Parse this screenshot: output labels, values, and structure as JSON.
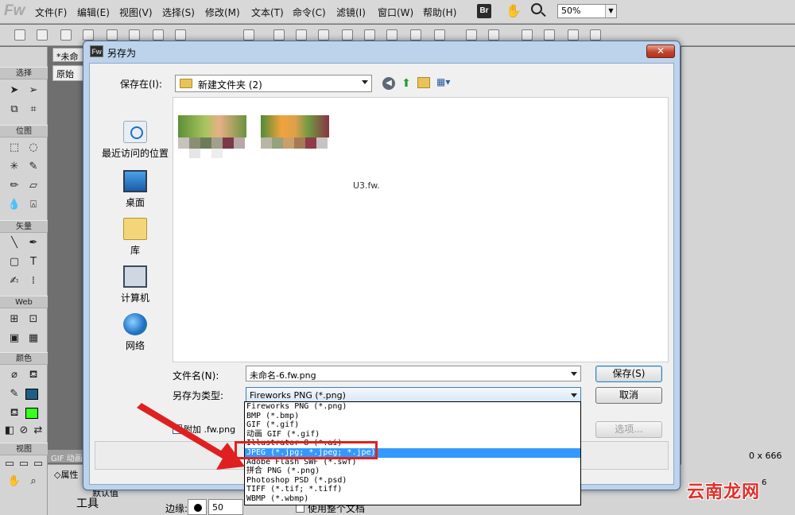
{
  "app": {
    "logo": "Fw"
  },
  "menubar": {
    "items": [
      "文件(F)",
      "编辑(E)",
      "视图(V)",
      "选择(S)",
      "修改(M)",
      "文本(T)",
      "命令(C)",
      "滤镜(I)",
      "窗口(W)",
      "帮助(H)"
    ],
    "br_label": "Br",
    "zoom": "50%"
  },
  "tools": {
    "sections": [
      "选择",
      "位图",
      "矢量",
      "Web",
      "颜色",
      "视图"
    ]
  },
  "document": {
    "tab": "*未命",
    "orig_tab": "原始"
  },
  "dialog": {
    "title": "另存为",
    "title_icon": "Fw",
    "close": "✕",
    "save_in_label": "保存在(I):",
    "save_in_value": "新建文件夹 (2)",
    "places": [
      "最近访问的位置",
      "桌面",
      "库",
      "计算机",
      "网络"
    ],
    "partial_filename": "U3.fw.",
    "filename_label": "文件名(N):",
    "filename_value": "未命名-6.fw.png",
    "filetype_label": "另存为类型:",
    "filetype_value": "Fireworks PNG (*.png)",
    "save_button": "保存(S)",
    "cancel_button": "取消",
    "options_button": "选项...",
    "append_label": "附加 .fw.png",
    "filetype_options": [
      "Fireworks PNG (*.png)",
      "BMP (*.bmp)",
      "GIF (*.gif)",
      "动画 GIF (*.gif)",
      "Illustrator 8 (*.ai)",
      "JPEG (*.jpg; *.jpeg; *.jpe)",
      "Adobe Flash SWF (*.swf)",
      "拼合 PNG (*.png)",
      "Photoshop PSD (*.psd)",
      "TIFF (*.tif; *.tiff)",
      "WBMP (*.wbmp)"
    ],
    "selected_option": "JPEG (*.jpg; *.jpeg; *.jpe)"
  },
  "bottom": {
    "gif_label": "GIF 动画",
    "props_label": "◇属性",
    "tool_label": "工具",
    "props_mini": "默认值",
    "edge_label": "边缘:",
    "edge_value": "50",
    "use_whole_doc": "使用整个文档",
    "size_label": "0 x 666",
    "right_digit": "6"
  },
  "watermark": "云南龙网"
}
